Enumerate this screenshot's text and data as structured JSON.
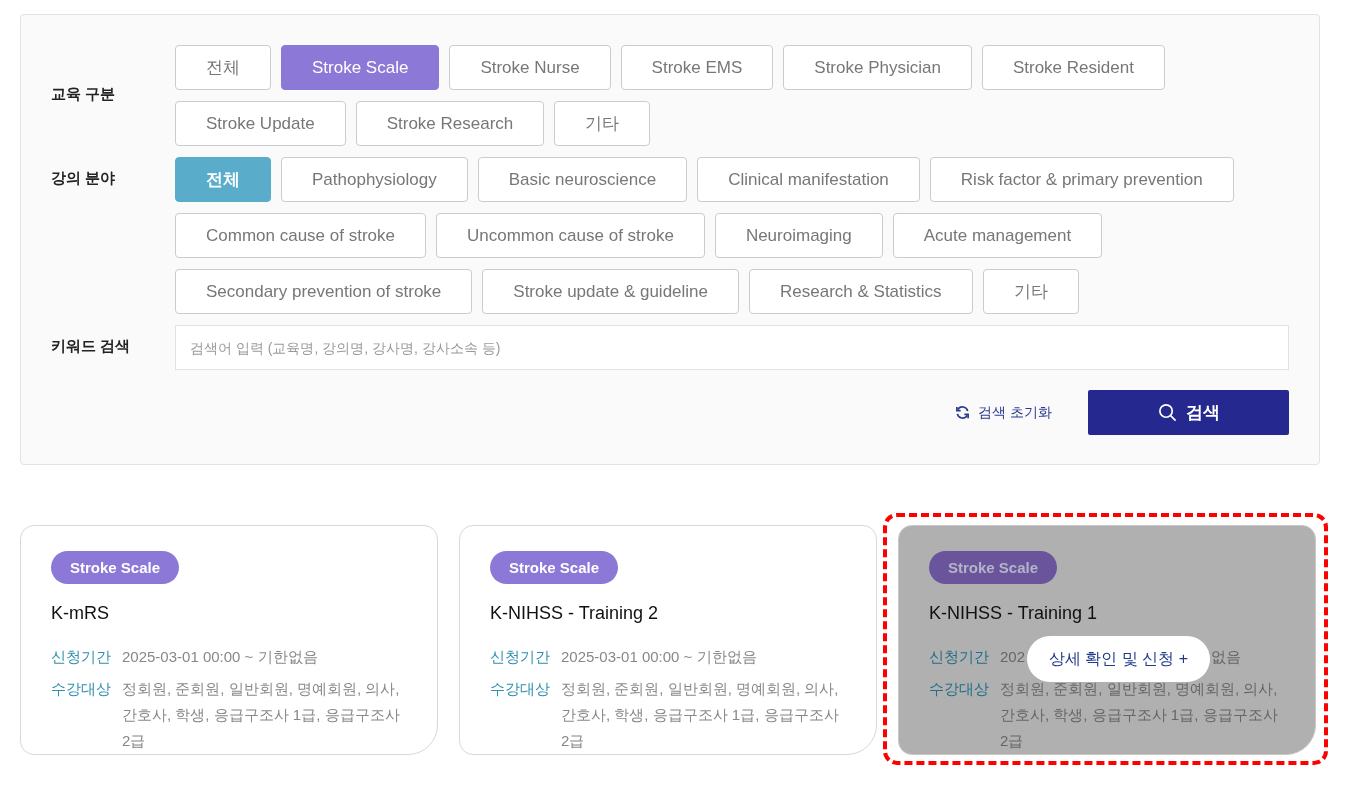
{
  "filters": {
    "groups": [
      {
        "label": "교육 구분",
        "kind": "category",
        "options": [
          {
            "label": "전체",
            "selected": false
          },
          {
            "label": "Stroke Scale",
            "selected": true
          },
          {
            "label": "Stroke Nurse",
            "selected": false
          },
          {
            "label": "Stroke EMS",
            "selected": false
          },
          {
            "label": "Stroke Physician",
            "selected": false
          },
          {
            "label": "Stroke Resident",
            "selected": false
          },
          {
            "label": "Stroke Update",
            "selected": false
          },
          {
            "label": "Stroke Research",
            "selected": false
          },
          {
            "label": "기타",
            "selected": false
          }
        ]
      },
      {
        "label": "강의 분야",
        "kind": "field",
        "options": [
          {
            "label": "전체",
            "selected": true
          },
          {
            "label": "Pathophysiology",
            "selected": false
          },
          {
            "label": "Basic neuroscience",
            "selected": false
          },
          {
            "label": "Clinical manifestation",
            "selected": false
          },
          {
            "label": "Risk factor & primary prevention",
            "selected": false
          },
          {
            "label": "Common cause of stroke",
            "selected": false
          },
          {
            "label": "Uncommon cause of stroke",
            "selected": false
          },
          {
            "label": "Neuroimaging",
            "selected": false
          },
          {
            "label": "Acute management",
            "selected": false
          },
          {
            "label": "Secondary prevention of stroke",
            "selected": false
          },
          {
            "label": "Stroke update & guideline",
            "selected": false
          },
          {
            "label": "Research & Statistics",
            "selected": false
          },
          {
            "label": "기타",
            "selected": false
          }
        ]
      }
    ],
    "keyword": {
      "label": "키워드 검색",
      "placeholder": "검색어 입력 (교육명, 강의명, 강사명, 강사소속 등)"
    },
    "reset_button": "검색 초기화",
    "search_button": "검색"
  },
  "courses": [
    {
      "tag": "Stroke Scale",
      "title": "K-mRS",
      "period_label": "신청기간",
      "period": "2025-03-01 00:00 ~ 기한없음",
      "target_label": "수강대상",
      "target": "정회원, 준회원, 일반회원, 명예회원, 의사, 간호사, 학생, 응급구조사 1급, 응급구조사 2급",
      "hovered": false,
      "highlighted": false
    },
    {
      "tag": "Stroke Scale",
      "title": "K-NIHSS - Training 2",
      "period_label": "신청기간",
      "period": "2025-03-01 00:00 ~ 기한없음",
      "target_label": "수강대상",
      "target": "정회원, 준회원, 일반회원, 명예회원, 의사, 간호사, 학생, 응급구조사 1급, 응급구조사 2급",
      "hovered": false,
      "highlighted": false
    },
    {
      "tag": "Stroke Scale",
      "title": "K-NIHSS - Training 1",
      "period_label": "신청기간",
      "period_parts": [
        "202",
        "없음"
      ],
      "target_label": "수강대상",
      "target": "정회원, 준회원, 일반회원, 명예회원, 의사, 간호사, 학생, 응급구조사 1급, 응급구조사 2급",
      "hovered": true,
      "hover_button": "상세 확인 및 신청 +",
      "highlighted": true
    }
  ]
}
